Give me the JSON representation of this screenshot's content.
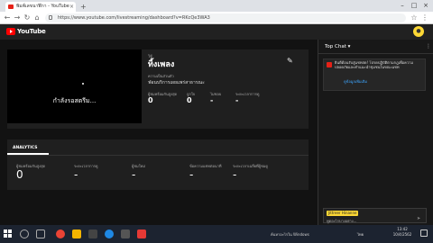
{
  "browser": {
    "tab_title": "พิมพ์เลขนาฬิกา - YouTube",
    "url": "https://www.youtube.com/livestreaming/dashboard?v=RKcQe3WA3",
    "tab_close": "×",
    "new_tab": "+",
    "window_controls": [
      "–",
      "□",
      "×"
    ]
  },
  "youtube": {
    "logo_text": "YouTube",
    "user_avatar": "●"
  },
  "stream": {
    "player_status": "กำลังรอสตรีม...",
    "subtitle": "ใช้",
    "title": "ทิ้งเพลง",
    "privacy_label": "ความเป็นส่วนตัว",
    "privacy_value": "ฟ่อนบริการเผยแพร่สาธารณะ",
    "stats": [
      {
        "label": "ผู้ชมพร้อมกันสูงสุด",
        "value": "0"
      },
      {
        "label": "ถูกใจ",
        "value": "0"
      },
      {
        "label": "ไม่ชอบ",
        "value": "-"
      },
      {
        "label": "ระยะเวลาการดู",
        "value": "-"
      }
    ]
  },
  "analytics": {
    "tab_label": "ANALYTICS",
    "metrics": [
      {
        "label": "ผู้ชมพร้อมกันสูงสุด",
        "value": "0"
      },
      {
        "label": "ระยะเวลาการดู",
        "value": "-"
      },
      {
        "label": "ผู้ชมใหม่",
        "value": "-"
      },
      {
        "label": "ข้อความแชทต่อนาที",
        "value": "-"
      },
      {
        "label": "ระยะเวลาเฉลี่ยที่ผู้ชมดู",
        "value": "-"
      }
    ]
  },
  "chat": {
    "header": "Top Chat ▾",
    "menu_icon": "⋮",
    "banner_text": "ยินดีต้อนรับสู่แชทสด! โปรดปฏิบัติตามกฎเพื่อความปลอดภัยและคำแนะนำชุมชนในขณะแชท",
    "banner_link": "ดูข้อมูลเพิ่มเติม",
    "user_badge": "Jittreer Hinanne",
    "input_placeholder": "พูดอะไรบางอย่าง...",
    "send_icon": "➤"
  },
  "taskbar": {
    "tray_text": "ค้นหาอะไรใน Windows",
    "lang": "ไทย",
    "time": "13:42",
    "date": "10/4/2562"
  }
}
